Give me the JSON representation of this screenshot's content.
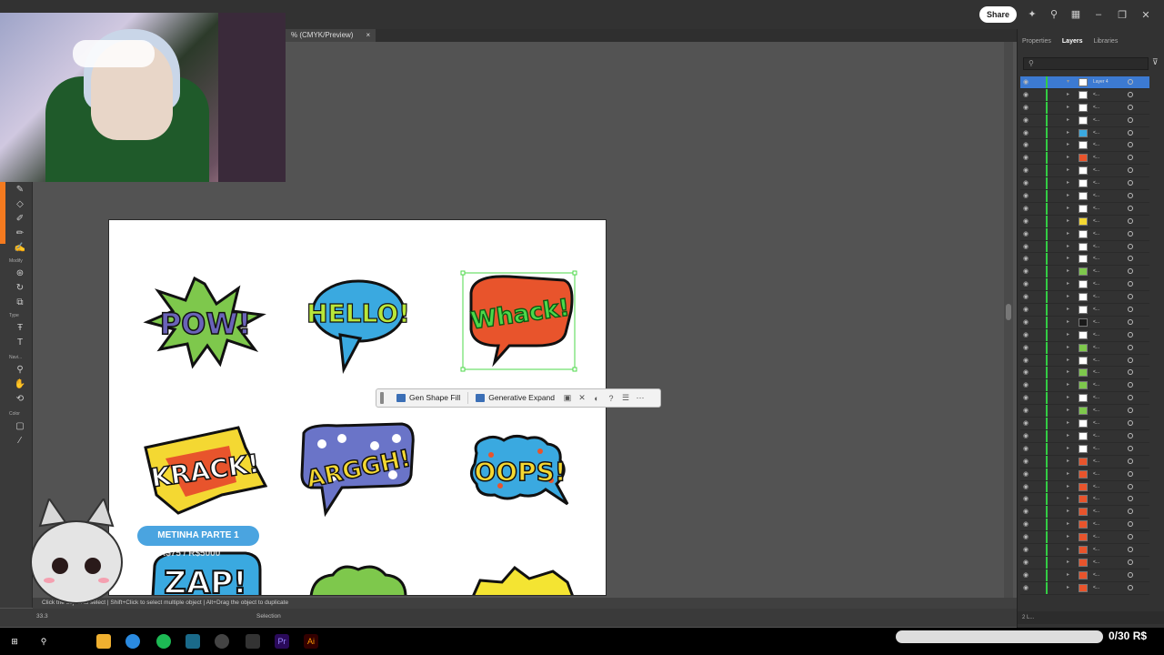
{
  "topbar": {
    "share_label": "Share"
  },
  "document": {
    "tab_title": "% (CMYK/Preview)",
    "tab_close": "×"
  },
  "toolbar": {
    "labels": {
      "modify": "Modify",
      "type": "Type",
      "navigate": "Navi...",
      "color": "Color"
    }
  },
  "context_bar": {
    "gen_shape_fill": "Gen Shape Fill",
    "generative_expand": "Generative Expand",
    "more": "⋯",
    "help": "?"
  },
  "stickers": [
    {
      "text": "POW!",
      "fill": "#7ec84c",
      "text_color": "#6a63b8"
    },
    {
      "text": "HELLO!",
      "fill": "#3aa9e0",
      "text_color": "#b8e63a"
    },
    {
      "text": "Whack!",
      "fill": "#e8542c",
      "text_color": "#4cd84a"
    },
    {
      "text": "KRACK!",
      "fill": "#f4d832",
      "text_color": "#fff"
    },
    {
      "text": "ARGGH!",
      "fill": "#6a74c8",
      "text_color": "#f4d832"
    },
    {
      "text": "OOPS!",
      "fill": "#3aa9e0",
      "text_color": "#f4d832"
    },
    {
      "text": "ZAP!",
      "fill": "#3aa9e0",
      "text_color": "#1a1a1a"
    },
    {
      "text": "",
      "fill": "#7ec84c",
      "text_color": "#1a1a1a"
    },
    {
      "text": "",
      "fill": "#f4e432",
      "text_color": "#1a1a1a"
    }
  ],
  "status": {
    "hint": "Click the object to select  |  Shift+Click to select multiple object  |  Alt+Drag the object to duplicate",
    "zoom": "33.3",
    "mode": "Selection"
  },
  "panel": {
    "tabs": [
      "Properties",
      "Layers",
      "Libraries"
    ],
    "active_tab": "Layers",
    "top_layer_name": "Layer 4",
    "child_label": "<...",
    "footer_count": "2 L..."
  },
  "overlay": {
    "badge": "METINHA PARTE 1",
    "sub": "R$75 / R$5000"
  },
  "goal": {
    "text": "0/30 R$"
  }
}
